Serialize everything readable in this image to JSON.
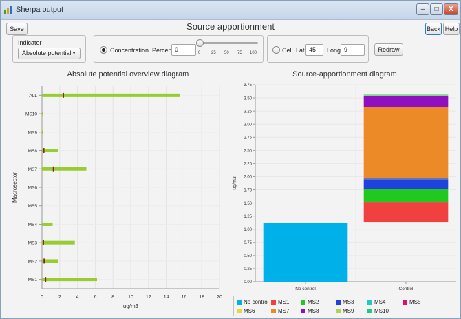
{
  "window": {
    "title": "Sherpa output",
    "controls": {
      "minimize": "–",
      "maximize": "□",
      "close": "X"
    }
  },
  "toolbar": {
    "save_label": "Save",
    "back_label": "Back",
    "help_label": "Help"
  },
  "page_title": "Source apportionment",
  "indicator": {
    "label": "Indicator",
    "selected": "Absolute potential"
  },
  "concentration": {
    "radio_label": "Concentration",
    "selected": true,
    "percentile_label": "Percentile",
    "percentile_value": "0",
    "slider_value": 0,
    "slider_ticks": [
      "0",
      "25",
      "50",
      "75",
      "100"
    ]
  },
  "cell": {
    "radio_label": "Cell",
    "selected": false,
    "lat_label": "Lat",
    "lat_value": "45",
    "long_label": "Long",
    "long_value": "9"
  },
  "redraw_label": "Redraw",
  "colors": {
    "bar_green": "#99cc33",
    "marker_brown": "#8b2323",
    "no_control": "#00b0e8",
    "MS1": "#f04040",
    "MS2": "#20c820",
    "MS3": "#2040e0",
    "MS4": "#20c8c8",
    "MS5": "#e01070",
    "MS6": "#e8d840",
    "MS7": "#ec8a28",
    "MS8": "#9010c0",
    "MS9": "#a8d848",
    "MS10": "#20c880"
  },
  "chart_data": [
    {
      "type": "bar",
      "orientation": "horizontal",
      "title": "Absolute potential overview diagram",
      "xlabel": "ug/m3",
      "ylabel": "Macrosector",
      "categories": [
        "ALL",
        "MS10",
        "MS9",
        "MS8",
        "MS7",
        "MS6",
        "MS5",
        "MS4",
        "MS3",
        "MS2",
        "MS1"
      ],
      "values": [
        15.5,
        0.05,
        0.15,
        1.8,
        5.0,
        0.0,
        0.0,
        1.2,
        3.7,
        1.8,
        6.2
      ],
      "markers": [
        2.4,
        0.0,
        0.0,
        0.2,
        1.3,
        0.0,
        0.0,
        0.0,
        0.15,
        0.25,
        0.4
      ],
      "xlim": [
        0,
        20
      ],
      "xticks": [
        "0",
        "2",
        "4",
        "6",
        "8",
        "10",
        "12",
        "14",
        "16",
        "18",
        "20"
      ],
      "grid": true
    },
    {
      "type": "bar",
      "stacked": true,
      "title": "Source-apportionment diagram",
      "xlabel": "",
      "ylabel": "ug/m3",
      "categories": [
        "No control",
        "Control"
      ],
      "ylim": [
        0,
        3.75
      ],
      "yticks": [
        "0.00",
        "0.25",
        "0.50",
        "0.75",
        "1.00",
        "1.25",
        "1.50",
        "1.75",
        "2.00",
        "2.25",
        "2.50",
        "2.75",
        "3.00",
        "3.25",
        "3.50",
        "3.75"
      ],
      "series": [
        {
          "name": "No control",
          "values": [
            1.12,
            0
          ]
        },
        {
          "name": "MS1",
          "values": [
            0,
            0.38
          ]
        },
        {
          "name": "MS2",
          "values": [
            0,
            0.25
          ]
        },
        {
          "name": "MS3",
          "values": [
            0,
            0.18
          ]
        },
        {
          "name": "MS4",
          "values": [
            0,
            0.01
          ]
        },
        {
          "name": "MS5",
          "values": [
            0,
            0.01
          ]
        },
        {
          "name": "MS6",
          "values": [
            0,
            0.0
          ]
        },
        {
          "name": "MS7",
          "values": [
            0,
            1.35
          ]
        },
        {
          "name": "MS8",
          "values": [
            0,
            0.22
          ]
        },
        {
          "name": "MS9",
          "values": [
            0,
            0.01
          ]
        },
        {
          "name": "MS10",
          "values": [
            0,
            0.01
          ]
        }
      ],
      "base": [
        0,
        1.14
      ],
      "legend_position": "bottom",
      "grid": true
    }
  ]
}
